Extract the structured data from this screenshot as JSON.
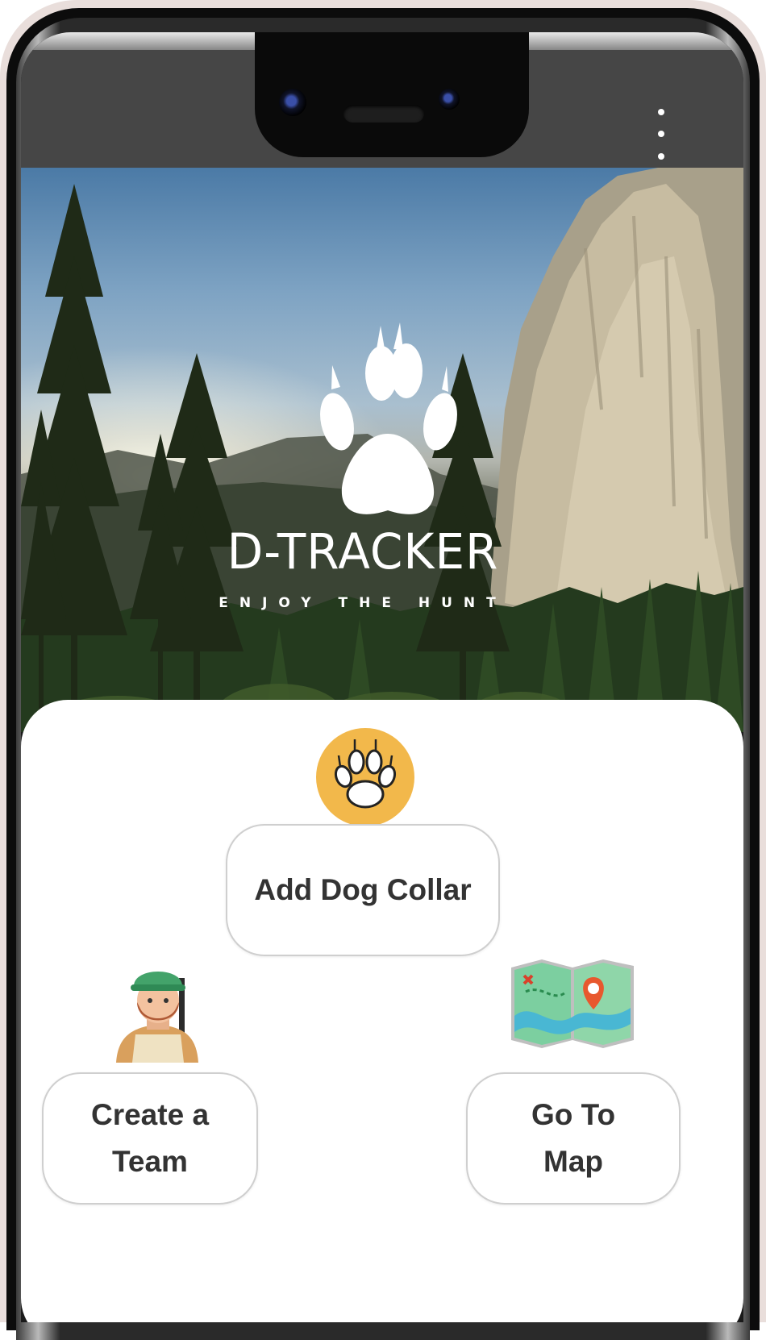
{
  "app": {
    "brand_name": "D-TRACKER",
    "tagline": "ENJOY THE HUNT"
  },
  "actions": {
    "add_dog_collar": "Add Dog Collar",
    "create_team_line1": "Create a",
    "create_team_line2": "Team",
    "go_to_map_line1": "Go To",
    "go_to_map_line2": "Map"
  },
  "icons": {
    "logo": "wolf-paw-icon",
    "add_dog_collar": "paw-badge-icon",
    "create_team": "hunter-avatar-icon",
    "go_to_map": "treasure-map-icon",
    "overflow_menu": "more-vertical-icon"
  },
  "colors": {
    "paw_badge": "#f2b84b",
    "button_text": "#333333",
    "button_border": "#cfcfcf",
    "map_pin": "#e8582e"
  }
}
